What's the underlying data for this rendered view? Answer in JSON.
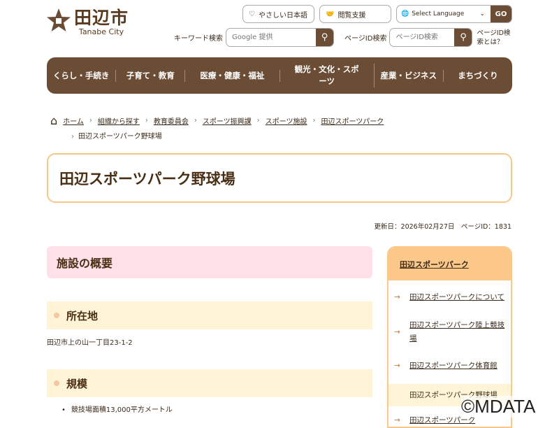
{
  "header": {
    "logo_jp": "田辺市",
    "logo_en": "Tanabe City",
    "easy_japanese": "やさしい日本語",
    "accessibility": "閲覧支援",
    "select_language": "Select Language",
    "go": "GO",
    "keyword_label": "キーワード検索",
    "keyword_placeholder": "Google 提供",
    "pageid_label": "ページID検索",
    "pageid_placeholder": "ページID検索",
    "pageid_help": "ページID検索とは？"
  },
  "nav": [
    "くらし・手続き",
    "子育て・教育",
    "医療・健康・福祉",
    "観光・文化・スポーツ",
    "産業・ビジネス",
    "まちづくり"
  ],
  "breadcrumb": [
    "ホーム",
    "組織から探す",
    "教育委員会",
    "スポーツ振興課",
    "スポーツ施設",
    "田辺スポーツパーク"
  ],
  "breadcrumb_current": "田辺スポーツパーク野球場",
  "page_title": "田辺スポーツパーク野球場",
  "updated": "更新日：2026年02月27日　ページID：1831",
  "main": {
    "section": "施設の概要",
    "location_h": "所在地",
    "location": "田辺市上の山一丁目23-1-2",
    "scale_h": "規模",
    "scale_items": [
      "競技場面積13,000平方メートル"
    ]
  },
  "sidebar": {
    "title": "田辺スポーツパーク",
    "items": [
      "田辺スポーツパークについて",
      "田辺スポーツパーク陸上競技場",
      "田辺スポーツパーク体育館"
    ],
    "current": "田辺スポーツパーク野球場",
    "next": "田辺スポーツパーク"
  },
  "watermark": "©MDATA"
}
